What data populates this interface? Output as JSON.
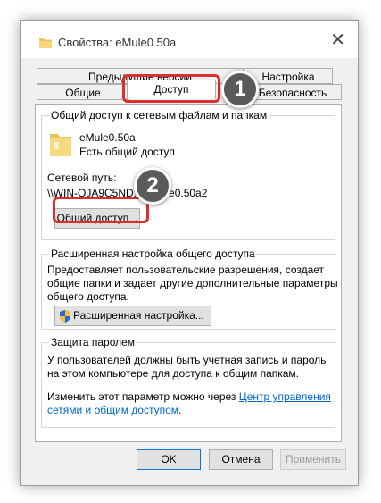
{
  "window": {
    "title": "Свойства: eMule0.50a",
    "close_glyph": "✕"
  },
  "tabs": {
    "previous_versions": "Предыдущие версии",
    "settings": "Настройка",
    "general": "Общие",
    "sharing": "Доступ",
    "security": "Безопасность"
  },
  "network_sharing": {
    "group_title": "Общий доступ к сетевым файлам и папкам",
    "folder_name": "eMule0.50a",
    "status": "Есть общий доступ",
    "path_label": "Сетевой путь:",
    "path_value": "\\\\WIN-OJA9C5ND...\\eMule0.50a2",
    "share_button": "Общий доступ..."
  },
  "advanced_sharing": {
    "group_title": "Расширенная настройка общего доступа",
    "desc_line1": "Предоставляет пользовательские разрешения, создает",
    "desc_line2": "общие папки и задает другие дополнительные параметры",
    "desc_line3": "общего доступа.",
    "button": "Расширенная настройка..."
  },
  "password_protection": {
    "group_title": "Защита паролем",
    "line1": "У пользователей должны быть учетная запись и пароль",
    "line2": "на этом компьютере для доступа к общим папкам.",
    "change_text": "Изменить этот параметр можно через",
    "link_part1": "Центр управления",
    "link_part2": "сетями и общим доступом",
    "link_end": "."
  },
  "buttons": {
    "ok": "OK",
    "cancel": "Отмена",
    "apply": "Применить"
  },
  "annotations": {
    "step1": "1",
    "step2": "2"
  },
  "colors": {
    "callout": "#d9302c",
    "badge": "#5a5a5a",
    "link": "#0066cc"
  }
}
